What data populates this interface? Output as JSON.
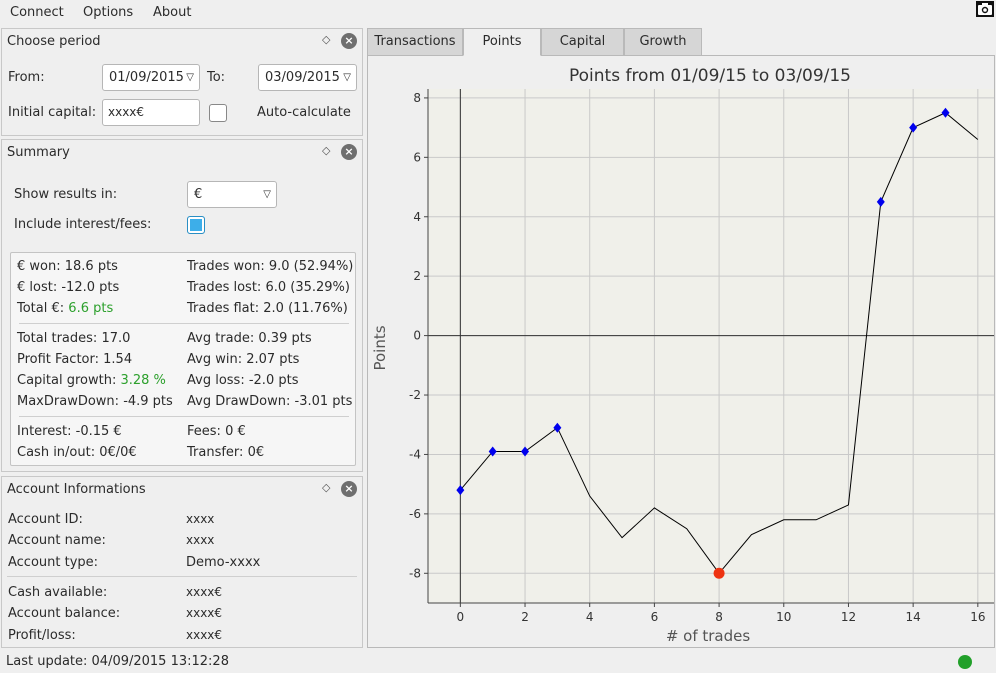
{
  "menu": {
    "connect": "Connect",
    "options": "Options",
    "about": "About"
  },
  "period": {
    "title": "Choose period",
    "from_label": "From:",
    "from_value": "01/09/2015",
    "to_label": "To:",
    "to_value": "03/09/2015",
    "capital_label": "Initial capital:",
    "capital_value": "xxxx€",
    "auto_label": "Auto-calculate",
    "auto_checked": false
  },
  "summary": {
    "title": "Summary",
    "show_label": "Show results in:",
    "show_value": "€",
    "include_label": "Include interest/fees:",
    "include_checked": true,
    "won_label": "€ won:",
    "won_value": "18.6 pts",
    "lost_label": "€ lost:",
    "lost_value": "-12.0 pts",
    "total_label": "Total €:",
    "total_value": "6.6 pts",
    "trades_won_label": "Trades won:",
    "trades_won_value": "9.0 (52.94%)",
    "trades_lost_label": "Trades lost:",
    "trades_lost_value": "6.0 (35.29%)",
    "trades_flat_label": "Trades flat:",
    "trades_flat_value": "2.0 (11.76%)",
    "total_trades_label": "Total trades:",
    "total_trades_value": "17.0",
    "profit_factor_label": "Profit Factor:",
    "profit_factor_value": "1.54",
    "capital_growth_label": "Capital growth:",
    "capital_growth_value": "3.28 %",
    "maxdd_label": "MaxDrawDown:",
    "maxdd_value": "-4.9 pts",
    "avg_trade_label": "Avg trade:",
    "avg_trade_value": "0.39 pts",
    "avg_win_label": "Avg win:",
    "avg_win_value": "2.07 pts",
    "avg_loss_label": "Avg loss:",
    "avg_loss_value": "-2.0 pts",
    "avg_dd_label": "Avg DrawDown:",
    "avg_dd_value": "-3.01 pts",
    "interest_label": "Interest:",
    "interest_value": "-0.15 €",
    "fees_label": "Fees:",
    "fees_value": "0 €",
    "cash_label": "Cash in/out:",
    "cash_value": "0€/0€",
    "transfer_label": "Transfer:",
    "transfer_value": "0€",
    "green_color": "#2ca02c"
  },
  "account": {
    "title": "Account Informations",
    "id_label": "Account ID:",
    "id_value": "xxxx",
    "name_label": "Account name:",
    "name_value": "xxxx",
    "type_label": "Account type:",
    "type_value": "Demo-xxxx",
    "cash_label": "Cash available:",
    "cash_value": "xxxx€",
    "balance_label": "Account balance:",
    "balance_value": "xxxx€",
    "pl_label": "Profit/loss:",
    "pl_value": "xxxx€"
  },
  "tabs": [
    "Transactions",
    "Points",
    "Capital",
    "Growth"
  ],
  "active_tab": "Points",
  "chart_data": {
    "type": "line",
    "title": "Points from 01/09/15 to 03/09/15",
    "xlabel": "# of trades",
    "ylabel": "Points",
    "x": [
      0,
      1,
      2,
      3,
      4,
      5,
      6,
      7,
      8,
      9,
      10,
      11,
      12,
      13,
      14,
      15,
      16
    ],
    "y": [
      -5.2,
      -3.9,
      -3.9,
      -3.1,
      -5.4,
      -6.8,
      -5.8,
      -6.5,
      -8.0,
      -6.7,
      -6.2,
      -6.2,
      -5.7,
      4.5,
      7.0,
      7.5,
      6.6
    ],
    "win_markers_x": [
      0,
      1,
      2,
      3,
      13,
      14,
      15
    ],
    "low_marker_x": [
      8
    ],
    "xlim": [
      -1,
      16.5
    ],
    "ylim": [
      -9,
      8.3
    ],
    "xticks": [
      0,
      2,
      4,
      6,
      8,
      10,
      12,
      14,
      16
    ],
    "yticks": [
      8,
      6,
      4,
      2,
      0,
      -2,
      -4,
      -6,
      -8
    ],
    "grid": true,
    "line_color": "#000000",
    "marker_color": "#0000ee",
    "low_marker_color": "#ee3311"
  },
  "status": {
    "text": "Last update: 04/09/2015 13:12:28",
    "dot_color": "#22a02a"
  }
}
